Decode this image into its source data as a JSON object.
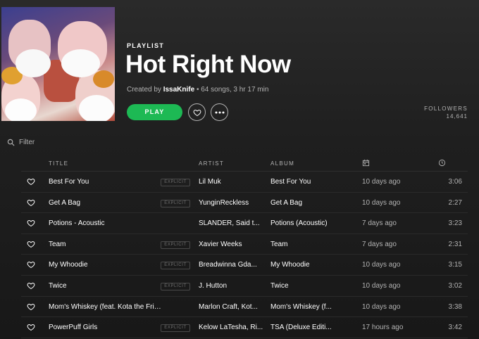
{
  "playlist": {
    "eyebrow": "PLAYLIST",
    "title": "Hot Right Now",
    "created_by_prefix": "Created by ",
    "owner": "IssaKnife",
    "stats": " • 64 songs, 3 hr 17 min",
    "play_label": "PLAY",
    "followers_label": "FOLLOWERS",
    "followers_count": "14,641"
  },
  "filter": {
    "placeholder": "Filter"
  },
  "columns": {
    "title": "TITLE",
    "artist": "ARTIST",
    "album": "ALBUM"
  },
  "tracks": [
    {
      "title": "Best For You",
      "explicit": "EXPLICIT",
      "artist": "Lil Muk",
      "album": "Best For You",
      "added": "10 days ago",
      "duration": "3:06"
    },
    {
      "title": "Get A Bag",
      "explicit": "EXPLICIT",
      "artist": "YunginReckless",
      "album": "Get A Bag",
      "added": "10 days ago",
      "duration": "2:27"
    },
    {
      "title": "Potions - Acoustic",
      "explicit": "",
      "artist": "SLANDER, Said t...",
      "album": "Potions (Acoustic)",
      "added": "7 days ago",
      "duration": "3:23"
    },
    {
      "title": "Team",
      "explicit": "EXPLICIT",
      "artist": "Xavier Weeks",
      "album": "Team",
      "added": "7 days ago",
      "duration": "2:31"
    },
    {
      "title": "My Whoodie",
      "explicit": "EXPLICIT",
      "artist": "Breadwinna Gda...",
      "album": "My Whoodie",
      "added": "10 days ago",
      "duration": "3:15"
    },
    {
      "title": "Twice",
      "explicit": "EXPLICIT",
      "artist": "J. Hutton",
      "album": "Twice",
      "added": "10 days ago",
      "duration": "3:02"
    },
    {
      "title": "Mom's Whiskey (feat. Kota the Friend)",
      "explicit": "",
      "artist": "Marlon Craft, Kot...",
      "album": "Mom's Whiskey (f...",
      "added": "10 days ago",
      "duration": "3:38"
    },
    {
      "title": "PowerPuff Girls",
      "explicit": "EXPLICIT",
      "artist": "Kelow LaTesha, Ri...",
      "album": "TSA (Deluxe Editi...",
      "added": "17 hours ago",
      "duration": "3:42"
    }
  ],
  "icons": {
    "heart": "heart-icon",
    "more": "more-icon",
    "search": "search-icon",
    "calendar": "calendar-icon",
    "clock": "clock-icon"
  },
  "colors": {
    "accent": "#1db954",
    "background": "#181818",
    "muted_text": "#b3b3b3"
  }
}
